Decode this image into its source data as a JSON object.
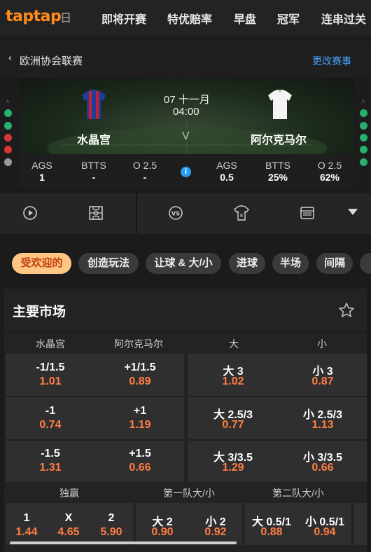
{
  "nav": {
    "logo": "taptap",
    "fade_item": "日",
    "items": [
      "即将开赛",
      "特优赔率",
      "早盘",
      "冠军",
      "连串过关"
    ]
  },
  "subheader": {
    "league": "欧洲协会联赛",
    "change_label": "更改赛事"
  },
  "match": {
    "date": "07 十一月",
    "time": "04:00",
    "vs": "V",
    "home": {
      "name": "水晶宫",
      "form": [
        "#28b06e",
        "#28b06e",
        "#d63636",
        "#d63636",
        "#9a9a9a"
      ]
    },
    "away": {
      "name": "阿尔克马尔",
      "form": [
        "#28b06e",
        "#28b06e",
        "#28b06e",
        "#28b06e",
        "#28b06e"
      ]
    }
  },
  "stats": {
    "home": [
      {
        "label": "AGS",
        "value": "1"
      },
      {
        "label": "BTTS",
        "value": "-"
      },
      {
        "label": "O 2.5",
        "value": "-"
      }
    ],
    "away": [
      {
        "label": "AGS",
        "value": "0.5"
      },
      {
        "label": "BTTS",
        "value": "25%"
      },
      {
        "label": "O 2.5",
        "value": "62%"
      }
    ],
    "info_icon": "info-icon"
  },
  "toolbar_icons": [
    "play-icon",
    "pitch-icon",
    "vs-icon",
    "jersey-icon",
    "scoreboard-icon",
    "dropdown-arrow-icon"
  ],
  "chips": [
    "受欢迎的",
    "创造玩法",
    "让球 & 大/小",
    "进球",
    "半场",
    "间隔"
  ],
  "market": {
    "title": "主要市场",
    "headers": [
      "水晶宫",
      "阿尔克马尔",
      "大",
      "小"
    ],
    "rows": [
      {
        "cells": [
          {
            "line": "-1/1.5",
            "odds": "1.01"
          },
          {
            "line": "+1/1.5",
            "odds": "0.89"
          },
          {
            "line": "大 3",
            "odds": "1.02"
          },
          {
            "line": "小 3",
            "odds": "0.87"
          }
        ]
      },
      {
        "cells": [
          {
            "line": "-1",
            "odds": "0.74"
          },
          {
            "line": "+1",
            "odds": "1.19"
          },
          {
            "line": "大 2.5/3",
            "odds": "0.77"
          },
          {
            "line": "小 2.5/3",
            "odds": "1.13"
          }
        ]
      },
      {
        "cells": [
          {
            "line": "-1.5",
            "odds": "1.31"
          },
          {
            "line": "+1.5",
            "odds": "0.66"
          },
          {
            "line": "大 3/3.5",
            "odds": "1.29"
          },
          {
            "line": "小 3/3.5",
            "odds": "0.66"
          }
        ]
      }
    ],
    "sections": [
      {
        "title": "独赢",
        "cells": [
          {
            "line": "1",
            "odds": "1.44"
          },
          {
            "line": "X",
            "odds": "4.65"
          },
          {
            "line": "2",
            "odds": "5.90"
          }
        ]
      },
      {
        "title": "第一队大/小",
        "cells": [
          {
            "line": "大 2",
            "odds": "0.90"
          },
          {
            "line": "小 2",
            "odds": "0.92"
          }
        ]
      },
      {
        "title": "第二队大/小",
        "cells": [
          {
            "line": "大 0.5/1",
            "odds": "0.88"
          },
          {
            "line": "小 0.5/1",
            "odds": "0.94"
          }
        ]
      }
    ]
  },
  "colors": {
    "accent": "#ff8a1d",
    "odds": "#ff7d45",
    "link": "#4aa3ff",
    "active_chip_bg": "#ffc685",
    "active_chip_text": "#c0420e"
  }
}
